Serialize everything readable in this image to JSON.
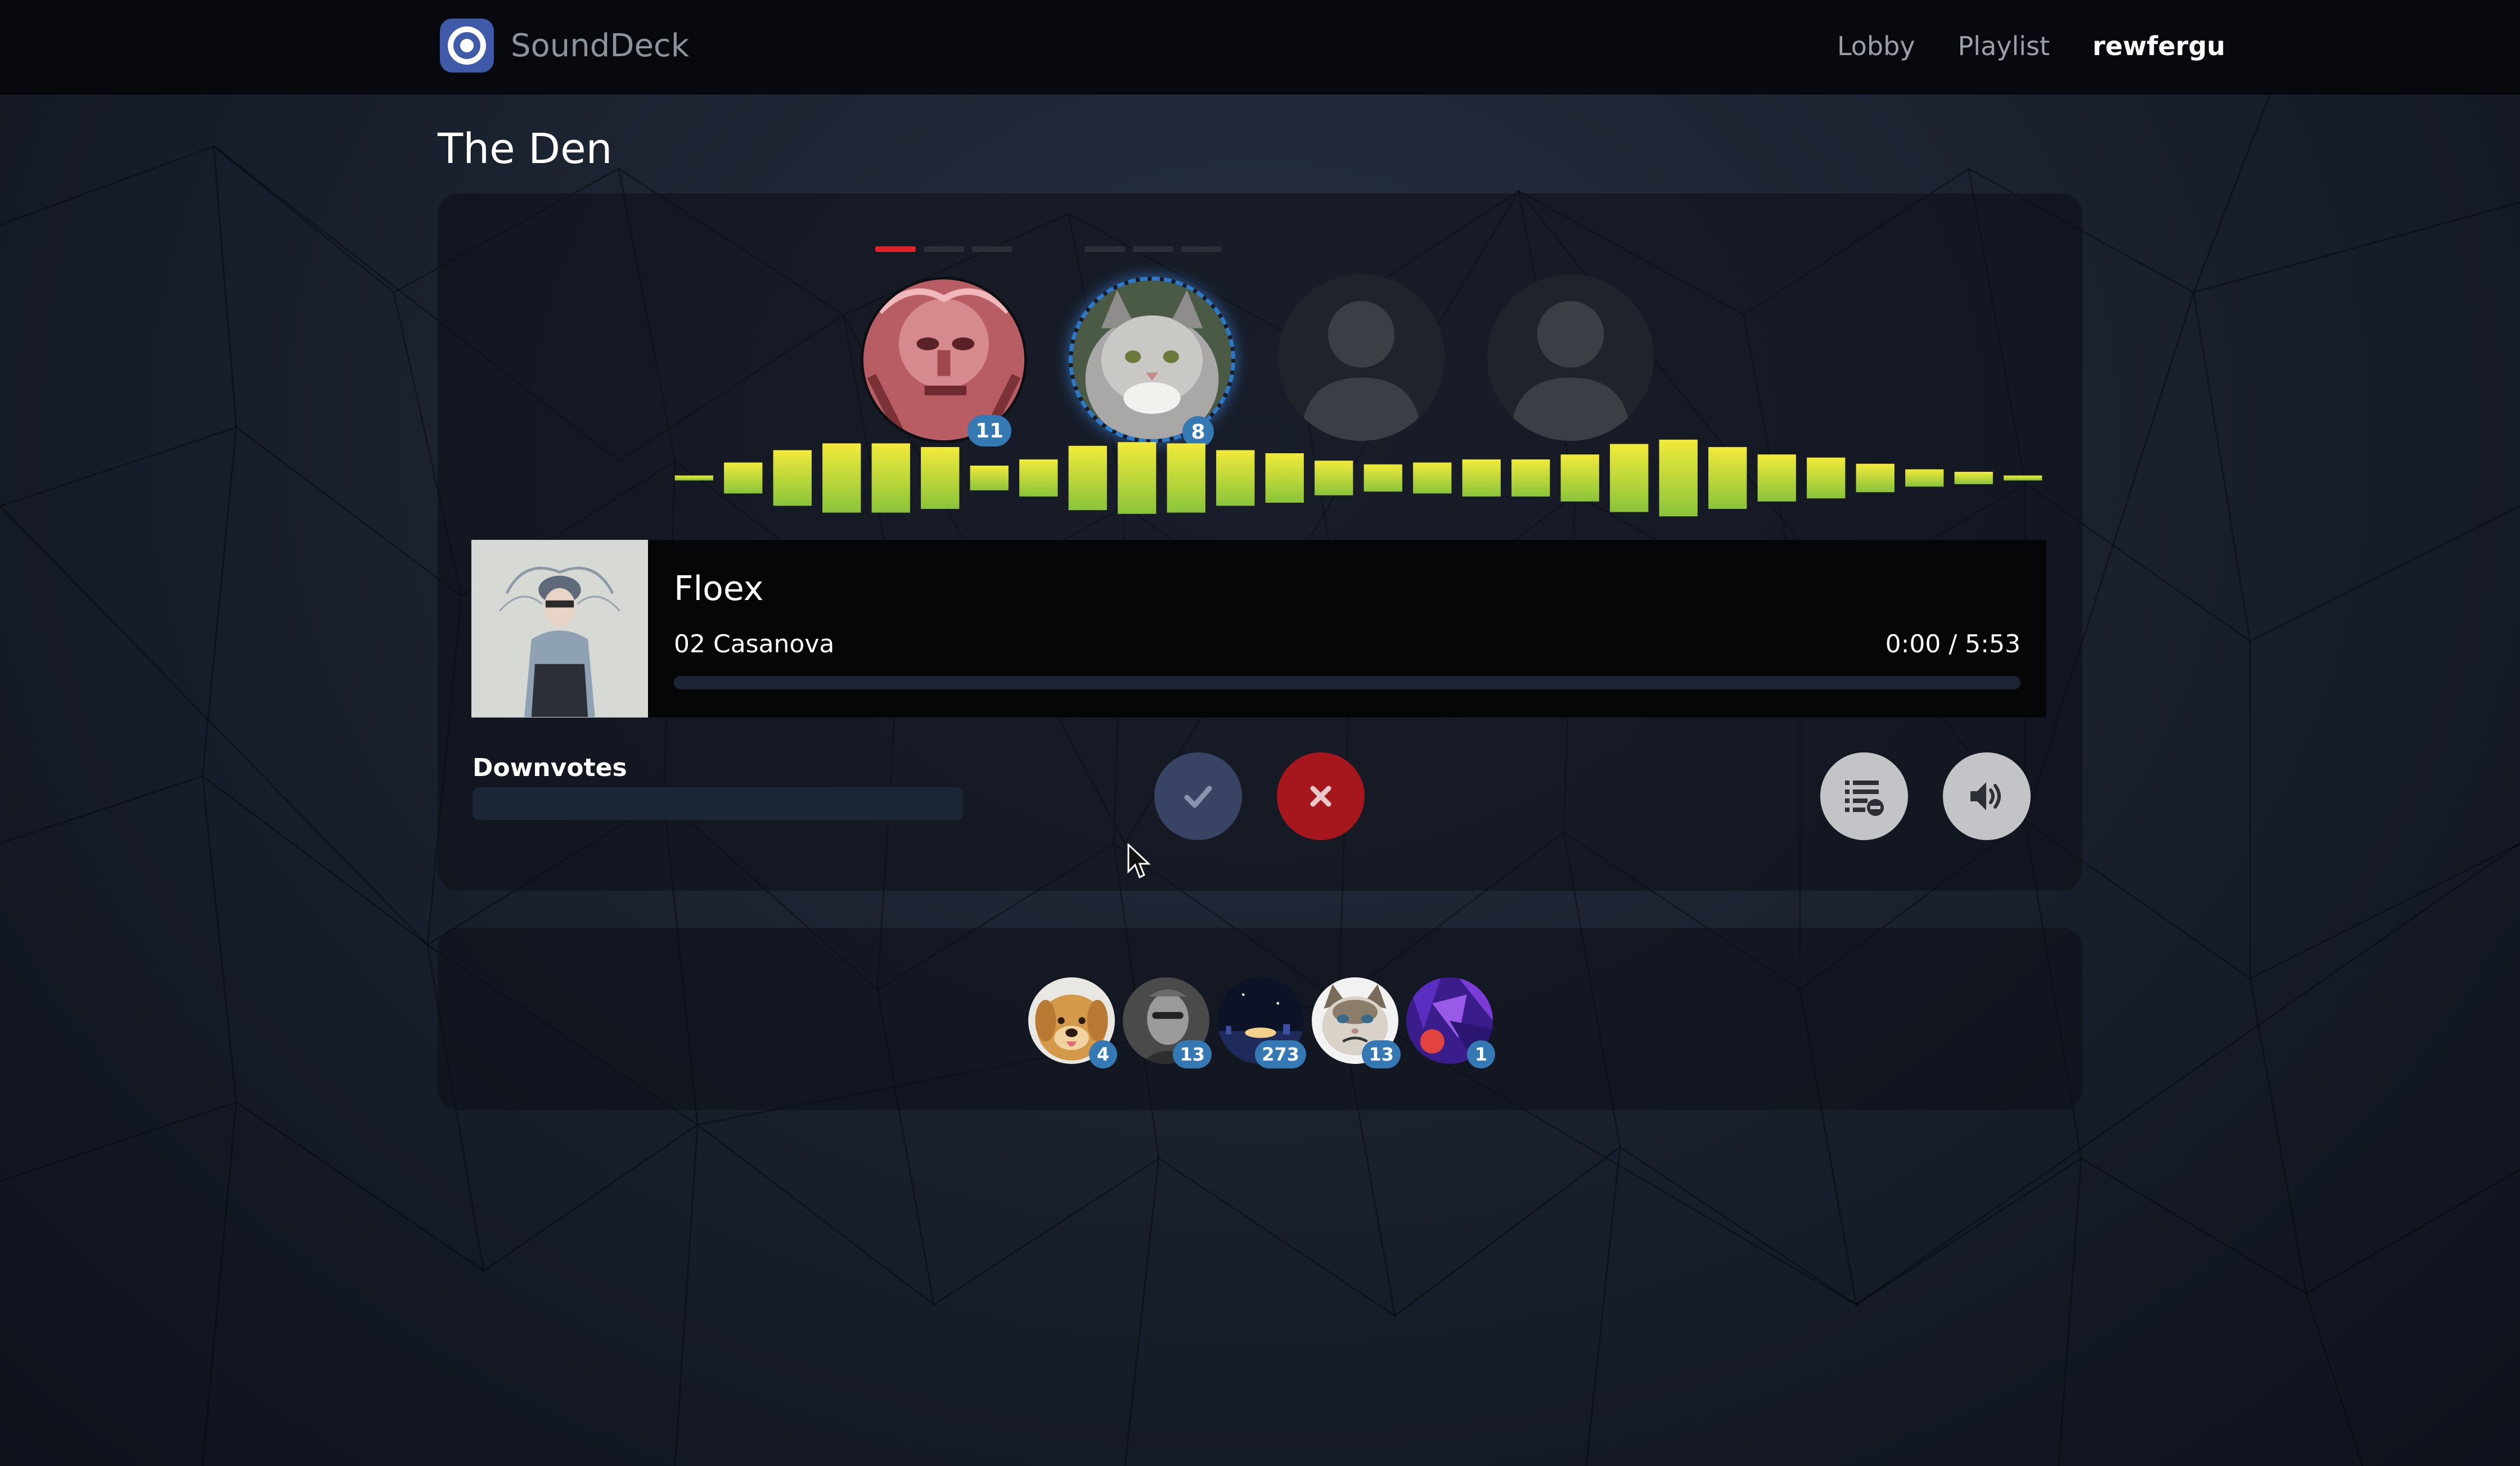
{
  "app": {
    "name": "SoundDeck"
  },
  "nav": {
    "links": [
      "Lobby",
      "Playlist"
    ],
    "user": "rewfergu"
  },
  "room": {
    "title": "The Den"
  },
  "djs": [
    {
      "slot": "dj-1",
      "count": "11",
      "votes_on": 1,
      "votes_total": 3,
      "state": "occupied"
    },
    {
      "slot": "dj-2",
      "count": "8",
      "votes_on": 0,
      "votes_total": 3,
      "state": "playing"
    },
    {
      "slot": "dj-3",
      "state": "empty"
    },
    {
      "slot": "dj-4",
      "state": "empty"
    }
  ],
  "visualizer_levels": [
    0.04,
    0.25,
    0.45,
    0.56,
    0.56,
    0.5,
    0.2,
    0.3,
    0.52,
    0.58,
    0.56,
    0.45,
    0.4,
    0.28,
    0.22,
    0.25,
    0.3,
    0.3,
    0.38,
    0.55,
    0.62,
    0.5,
    0.38,
    0.33,
    0.23,
    0.14,
    0.1,
    0.04
  ],
  "now_playing": {
    "artist": "Floex",
    "track": "02 Casanova",
    "time": "0:00 / 5:53",
    "progress": 0.0
  },
  "downvotes": {
    "label": "Downvotes",
    "level": 0.0
  },
  "controls": {
    "upvote_icon": "check-icon",
    "downvote_icon": "close-icon",
    "queue_icon": "list-remove-icon",
    "volume_icon": "volume-icon"
  },
  "listeners": [
    {
      "name": "listener-1",
      "count": "4"
    },
    {
      "name": "listener-2",
      "count": "13"
    },
    {
      "name": "listener-3",
      "count": "273"
    },
    {
      "name": "listener-4",
      "count": "13"
    },
    {
      "name": "listener-5",
      "count": "1"
    }
  ],
  "colors": {
    "accent_blue": "#3579b4",
    "downvote_red": "#a5161d",
    "bar_top": "#f2ea3a",
    "bar_bottom": "#8ac43a"
  }
}
